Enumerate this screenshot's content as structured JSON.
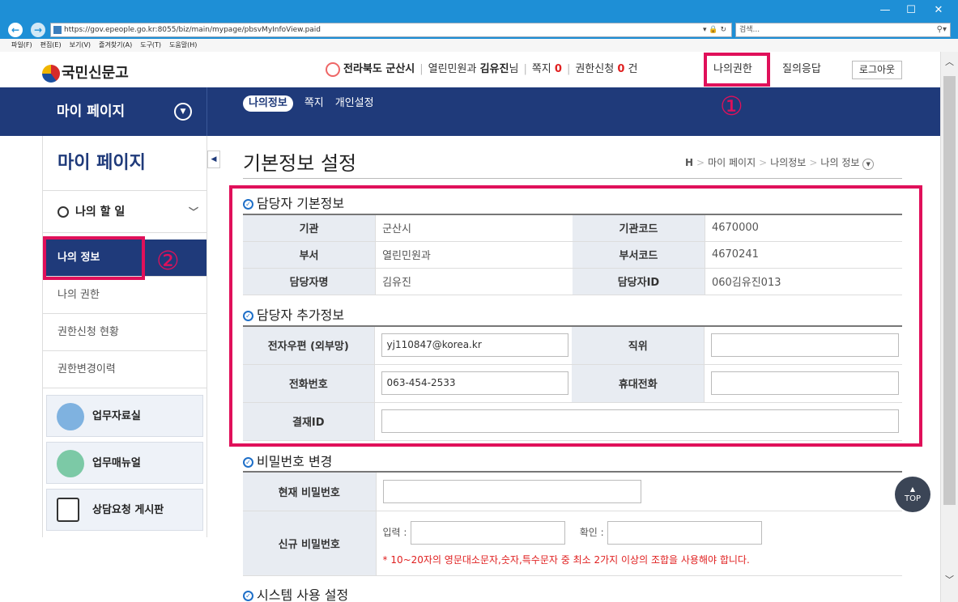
{
  "browser": {
    "url": "https://gov.epeople.go.kr:8055/biz/main/mypage/pbsvMyInfoView.paid",
    "search_placeholder": "검색...",
    "menu": [
      "파일(F)",
      "편집(E)",
      "보기(V)",
      "즐겨찾기(A)",
      "도구(T)",
      "도움말(H)"
    ]
  },
  "header": {
    "logo": "국민신문고",
    "region": "전라북도 군산시",
    "dept": "열린민원과",
    "user": "김유진",
    "user_suffix": "님",
    "notes_label": "쪽지",
    "notes_count": "0",
    "req_label": "권한신청",
    "req_count": "0",
    "req_unit": "건",
    "my_perm": "나의권한",
    "qna": "질의응답",
    "logout": "로그아웃"
  },
  "nav": {
    "mypage": "마이 페이지",
    "tabs": [
      "나의정보",
      "쪽지",
      "개인설정"
    ]
  },
  "annotations": {
    "one": "①",
    "two": "②"
  },
  "sidebar": {
    "title": "마이 페이지",
    "todo": "나의 할 일",
    "items": [
      "나의 정보",
      "나의 권한",
      "권한신청 현황",
      "권한변경이력"
    ],
    "cards": [
      "업무자료실",
      "업무매뉴얼",
      "상담요청 게시판"
    ]
  },
  "page": {
    "title": "기본정보 설정",
    "breadcrumb": [
      "H",
      "마이 페이지",
      "나의정보",
      "나의 정보"
    ]
  },
  "basic": {
    "title": "담당자 기본정보",
    "rows": [
      {
        "l1": "기관",
        "v1": "군산시",
        "l2": "기관코드",
        "v2": "4670000"
      },
      {
        "l1": "부서",
        "v1": "열린민원과",
        "l2": "부서코드",
        "v2": "4670241"
      },
      {
        "l1": "담당자명",
        "v1": "김유진",
        "l2": "담당자ID",
        "v2": "060김유진013"
      }
    ]
  },
  "extra": {
    "title": "담당자 추가정보",
    "email_label": "전자우편 (외부망)",
    "email": "yj110847@korea.kr",
    "position_label": "직위",
    "phone_label": "전화번호",
    "phone": "063-454-2533",
    "mobile_label": "휴대전화",
    "approval_label": "결재ID"
  },
  "password": {
    "title": "비밀번호 변경",
    "current_label": "현재 비밀번호",
    "new_label": "신규 비밀번호",
    "input_label": "입력 :",
    "confirm_label": "확인 :",
    "note": "* 10~20자의 영문대소문자,숫자,특수문자 중 최소 2가지 이상의 조합을 사용해야 합니다."
  },
  "system": {
    "title": "시스템 사용 설정"
  },
  "top_button": "TOP",
  "colors": {
    "navy": "#1f3a7a",
    "highlight": "#e0105a",
    "red": "#e02020"
  }
}
